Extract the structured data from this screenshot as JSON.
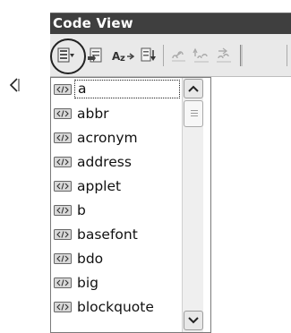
{
  "window": {
    "title": "Code View"
  },
  "toolbar": {
    "buttons": [
      {
        "icon": "tag-list-icon",
        "circled": true
      },
      {
        "icon": "insert-tag-icon"
      },
      {
        "icon": "attribute-az-icon"
      },
      {
        "icon": "sort-down-icon"
      },
      {
        "icon": "link-icon"
      },
      {
        "icon": "link-forward-icon"
      },
      {
        "icon": "link-back-icon"
      }
    ]
  },
  "tag_list": {
    "items": [
      "a",
      "abbr",
      "acronym",
      "address",
      "applet",
      "b",
      "basefont",
      "bdo",
      "big",
      "blockquote"
    ],
    "selected_index": 0,
    "item_icon": "tag-icon"
  },
  "scrollbar": {
    "up_icon": "chevron-up-icon",
    "down_icon": "chevron-down-icon"
  },
  "marker_icon": "caret-marker-icon"
}
